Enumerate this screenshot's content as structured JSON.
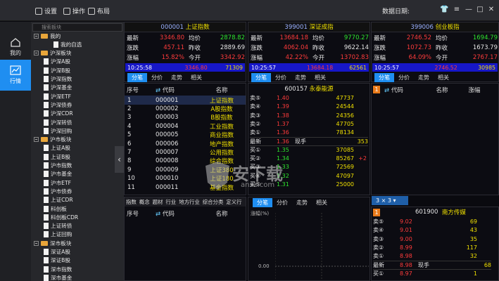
{
  "titlebar": {
    "settings": "设置",
    "operate": "操作",
    "layout": "布局",
    "data_date": "数据日期:"
  },
  "leftbar": {
    "mine": "我的",
    "quotes": "行情"
  },
  "tree": {
    "search_placeholder": "搜索板块",
    "items": [
      {
        "t": "folder",
        "label": "我的",
        "indent": 0
      },
      {
        "t": "doc",
        "label": "我的自选",
        "indent": 2
      },
      {
        "t": "folder",
        "label": "沪深板块",
        "indent": 0
      },
      {
        "t": "doc",
        "label": "沪深A股",
        "indent": 1
      },
      {
        "t": "doc",
        "label": "沪深B股",
        "indent": 1
      },
      {
        "t": "doc",
        "label": "沪深指数",
        "indent": 1
      },
      {
        "t": "doc",
        "label": "沪深基金",
        "indent": 1
      },
      {
        "t": "doc",
        "label": "沪深ETF",
        "indent": 1
      },
      {
        "t": "doc",
        "label": "沪深债券",
        "indent": 1
      },
      {
        "t": "doc",
        "label": "沪深CDR",
        "indent": 1
      },
      {
        "t": "doc",
        "label": "沪深转债",
        "indent": 1
      },
      {
        "t": "doc",
        "label": "沪深回购",
        "indent": 1
      },
      {
        "t": "folder",
        "label": "沪市板块",
        "indent": 0
      },
      {
        "t": "doc",
        "label": "上证A股",
        "indent": 1
      },
      {
        "t": "doc",
        "label": "上证B股",
        "indent": 1
      },
      {
        "t": "doc",
        "label": "沪市指数",
        "indent": 1
      },
      {
        "t": "doc",
        "label": "沪市基金",
        "indent": 1
      },
      {
        "t": "doc",
        "label": "沪市ETF",
        "indent": 1
      },
      {
        "t": "doc",
        "label": "沪市债券",
        "indent": 1
      },
      {
        "t": "doc",
        "label": "上证CDR",
        "indent": 1
      },
      {
        "t": "doc",
        "label": "科创板",
        "indent": 1
      },
      {
        "t": "doc",
        "label": "科创板CDR",
        "indent": 1
      },
      {
        "t": "doc",
        "label": "上证转债",
        "indent": 1
      },
      {
        "t": "doc",
        "label": "上证回购",
        "indent": 1
      },
      {
        "t": "folder",
        "label": "深市板块",
        "indent": 0
      },
      {
        "t": "doc",
        "label": "深证A股",
        "indent": 1
      },
      {
        "t": "doc",
        "label": "深证B股",
        "indent": 1
      },
      {
        "t": "doc",
        "label": "深市指数",
        "indent": 1
      },
      {
        "t": "doc",
        "label": "深市基金",
        "indent": 1
      }
    ]
  },
  "indices": [
    {
      "code": "000001",
      "name": "上证指数",
      "latest": "3346.80",
      "avg": "2878.82",
      "chg": "457.11",
      "prev": "2889.69",
      "pct": "15.82%",
      "open": "3342.92",
      "tk_time": "10:25:58",
      "tk_price": "3346.80",
      "tk_vol": "71309"
    },
    {
      "code": "399001",
      "name": "深证成指",
      "latest": "13684.18",
      "avg": "9770.27",
      "chg": "4062.04",
      "prev": "9622.14",
      "pct": "42.22%",
      "open": "13702.83",
      "tk_time": "10:25:57",
      "tk_price": "13684.18",
      "tk_vol": "62561"
    },
    {
      "code": "399006",
      "name": "创业板指",
      "latest": "2746.52",
      "avg": "1694.79",
      "chg": "1072.73",
      "prev": "1673.79",
      "pct": "64.09%",
      "open": "2767.17",
      "tk_time": "10:25:57",
      "tk_price": "2746.52",
      "tk_vol": "30985"
    }
  ],
  "idx_labels": {
    "latest": "最新",
    "avg": "均价",
    "chg": "涨跌",
    "prev": "昨收",
    "pct": "涨幅",
    "open": "今开"
  },
  "tabs": [
    "分笔",
    "分价",
    "走势",
    "相关"
  ],
  "list": {
    "headers": [
      "序号",
      "代码",
      "名称"
    ],
    "rows": [
      [
        "1",
        "000001",
        "上证指数"
      ],
      [
        "2",
        "000002",
        "A股指数"
      ],
      [
        "3",
        "000003",
        "B股指数"
      ],
      [
        "4",
        "000004",
        "工业指数"
      ],
      [
        "5",
        "000005",
        "商业指数"
      ],
      [
        "6",
        "000006",
        "地产指数"
      ],
      [
        "7",
        "000007",
        "公用指数"
      ],
      [
        "8",
        "000008",
        "综合指数"
      ],
      [
        "9",
        "000009",
        "上证380"
      ],
      [
        "10",
        "000010",
        "上证180"
      ],
      [
        "11",
        "000011",
        "基金指数"
      ]
    ]
  },
  "bottom_tabs": [
    "指数",
    "概念",
    "题材",
    "行业",
    "地方行业",
    "综合分类",
    "定义行"
  ],
  "bottom_headers": [
    "序号",
    "代码",
    "名称"
  ],
  "stock1": {
    "code": "600157",
    "name": "永泰能源",
    "asks": [
      [
        "卖⑤",
        "1.40",
        "47737"
      ],
      [
        "卖④",
        "1.39",
        "24544"
      ],
      [
        "卖③",
        "1.38",
        "24356"
      ],
      [
        "卖②",
        "1.37",
        "47705"
      ],
      [
        "卖①",
        "1.36",
        "78134"
      ]
    ],
    "last": [
      "最新",
      "1.36",
      "现手",
      "353"
    ],
    "bids": [
      [
        "买①",
        "1.35",
        "37085",
        ""
      ],
      [
        "买②",
        "1.34",
        "85267",
        "+2"
      ],
      [
        "买③",
        "1.33",
        "72569",
        ""
      ],
      [
        "买④",
        "1.32",
        "47097",
        ""
      ],
      [
        "买⑤",
        "1.31",
        "25000",
        ""
      ]
    ]
  },
  "chart": {
    "ylabel": "涨幅(%)",
    "zero": "0.00"
  },
  "right_list": {
    "badge": "1",
    "headers": [
      "代码",
      "名称",
      "涨幅"
    ],
    "layout_sel": "3 × 3"
  },
  "stock2": {
    "badge": "1",
    "code": "601900",
    "name": "南方传媒",
    "asks": [
      [
        "卖⑤",
        "9.02",
        "69"
      ],
      [
        "卖④",
        "9.01",
        "43"
      ],
      [
        "卖③",
        "9.00",
        "35"
      ],
      [
        "卖②",
        "8.99",
        "117"
      ],
      [
        "卖①",
        "8.98",
        "32"
      ]
    ],
    "last": [
      "最新",
      "8.98",
      "现手",
      "68"
    ],
    "bids": [
      [
        "买①",
        "8.97",
        "1"
      ]
    ]
  },
  "watermark": {
    "main": "安下载",
    "sub": "anxz.com"
  },
  "colors": {
    "accent": "#1f8ef1",
    "up": "#ff3b3b",
    "down": "#2ee62e",
    "title": "#f0e000"
  }
}
